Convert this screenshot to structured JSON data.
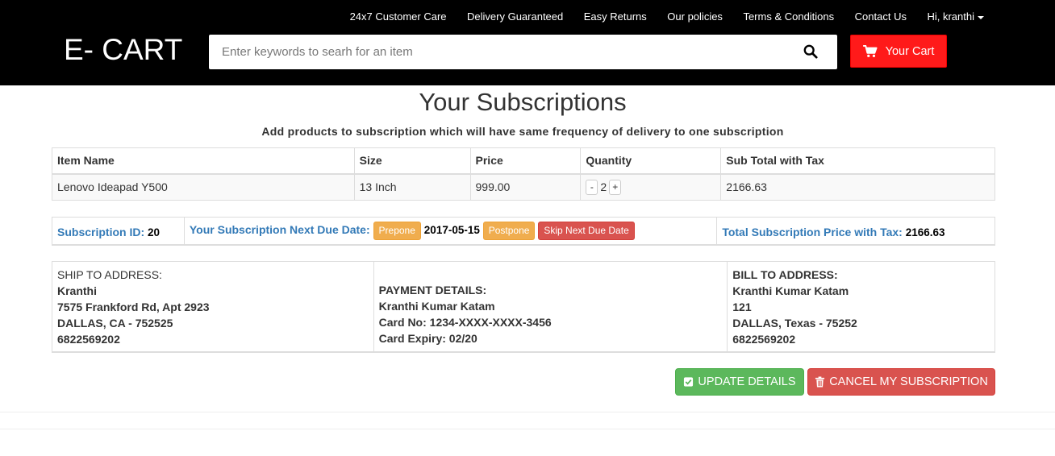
{
  "header": {
    "nav": [
      {
        "label": "24x7 Customer Care"
      },
      {
        "label": "Delivery Guaranteed"
      },
      {
        "label": "Easy Returns"
      },
      {
        "label": "Our policies"
      },
      {
        "label": "Terms & Conditions"
      },
      {
        "label": "Contact Us"
      }
    ],
    "user_menu": "Hi, kranthi",
    "logo": "E- CART",
    "search_placeholder": "Enter keywords to searh for an item",
    "search_icon": "search-icon",
    "cart_label": "Your Cart",
    "cart_icon": "shopping-cart-icon",
    "cart_color": "#ff1a1a"
  },
  "page": {
    "title": "Your Subscriptions",
    "subtitle": "Add products to subscription which will have same frequency of delivery to one subscription"
  },
  "items_table": {
    "headers": [
      "Item Name",
      "Size",
      "Price",
      "Quantity",
      "Sub Total with Tax"
    ],
    "rows": [
      {
        "name": "Lenovo Ideapad Y500",
        "size": "13 Inch",
        "price": "999.00",
        "qty_minus": "-",
        "quantity": "2",
        "qty_plus": "+",
        "subtotal": "2166.63"
      }
    ]
  },
  "subscription": {
    "id_label": "Subscription ID:",
    "id_value": "20",
    "due_label": "Your Subscription Next Due Date:",
    "prepone_label": "Prepone",
    "due_date": "2017-05-15",
    "postpone_label": "Postpone",
    "skip_label": "Skip Next Due Date",
    "total_label": "Total Subscription Price with Tax:",
    "total_value": "2166.63"
  },
  "ship_to": {
    "heading": "SHIP TO ADDRESS:",
    "name": "Kranthi",
    "street": "7575 Frankford Rd, Apt 2923",
    "city": "DALLAS, CA - 752525",
    "phone": "6822569202"
  },
  "payment": {
    "heading": "PAYMENT DETAILS:",
    "name": "Kranthi Kumar Katam",
    "card": "Card No: 1234-XXXX-XXXX-3456",
    "expiry": "Card Expiry: 02/20"
  },
  "bill_to": {
    "heading": "BILL TO ADDRESS:",
    "name": "Kranthi Kumar Katam",
    "street": "121",
    "city": "DALLAS, Texas - 75252",
    "phone": "6822569202"
  },
  "actions": {
    "update_label": "UPDATE DETAILS",
    "update_icon": "check-square-icon",
    "cancel_label": "CANCEL MY SUBSCRIPTION",
    "cancel_icon": "trash-icon"
  },
  "colors": {
    "accent_blue": "#337ab7",
    "success": "#5cb85c",
    "danger": "#d9534f",
    "warning": "#f0ad4e"
  }
}
